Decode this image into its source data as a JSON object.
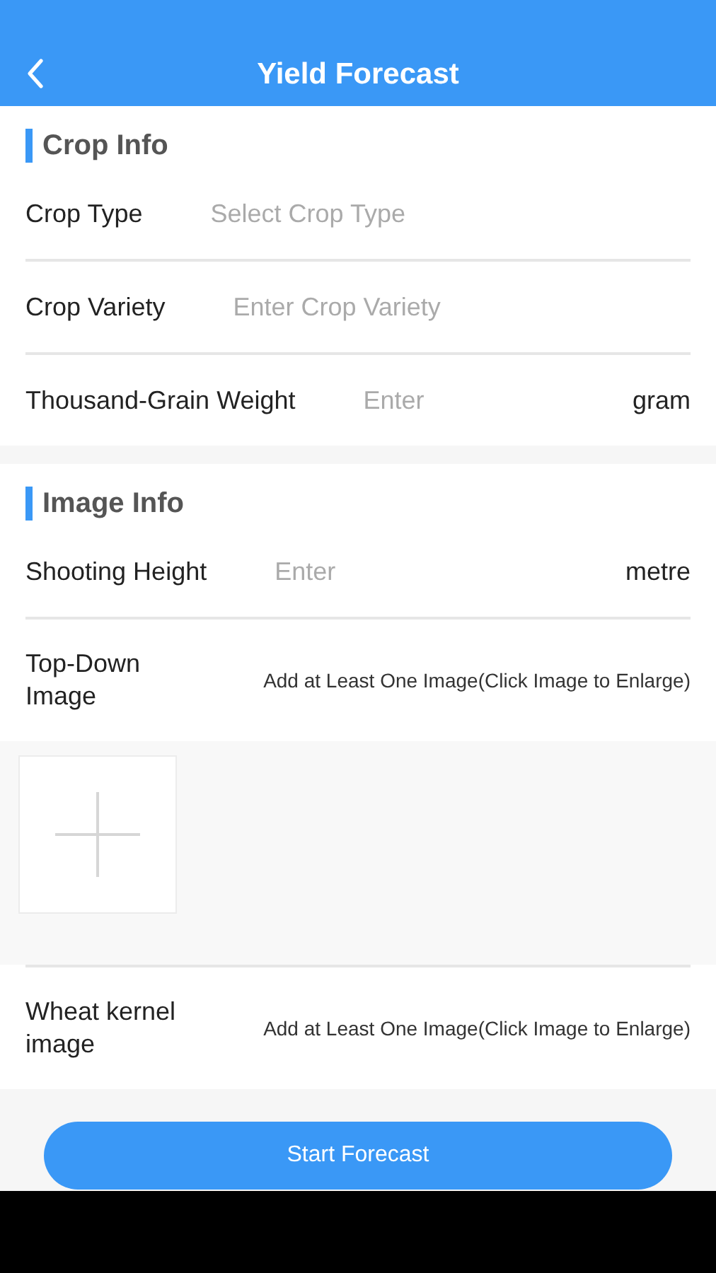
{
  "header": {
    "title": "Yield Forecast"
  },
  "sections": [
    {
      "title": "Crop Info",
      "fields": [
        {
          "kind": "select",
          "label": "Crop Type",
          "placeholder": "Select Crop Type"
        },
        {
          "kind": "input",
          "label": "Crop Variety",
          "placeholder": "Enter Crop Variety"
        },
        {
          "kind": "input",
          "label": "Thousand-Grain Weight",
          "placeholder": "Enter",
          "unit": "gram"
        }
      ]
    },
    {
      "title": "Image Info",
      "fields": [
        {
          "kind": "input",
          "label": "Shooting Height",
          "placeholder": "Enter",
          "unit": "metre"
        },
        {
          "kind": "image",
          "label": "Top-Down Image",
          "hint": "Add at Least One Image(Click Image to Enlarge)",
          "expanded": true
        },
        {
          "kind": "image",
          "label": "Wheat kernel image",
          "hint": "Add at Least One Image(Click Image to Enlarge)",
          "expanded": false
        }
      ]
    }
  ],
  "submit_button": "Start Forecast"
}
